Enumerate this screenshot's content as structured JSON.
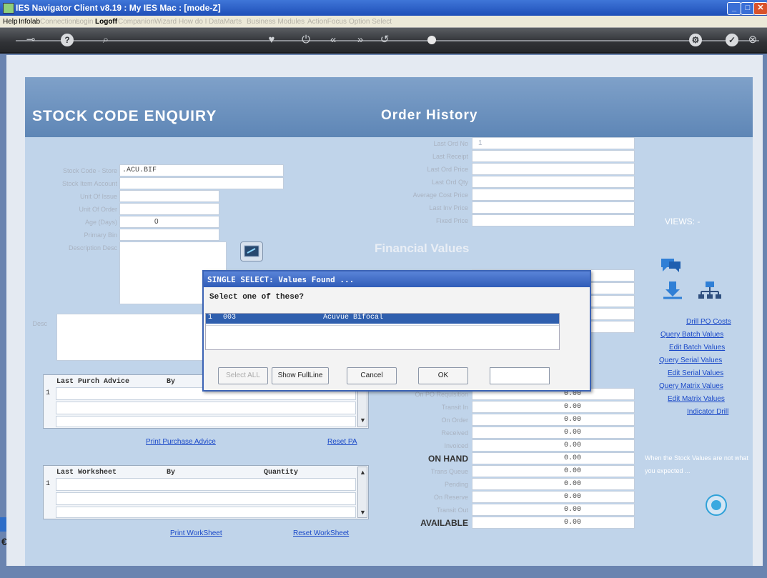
{
  "window": {
    "title": "IES Navigator Client v8.19 : My IES  Mac :      [mode-Z]"
  },
  "menu": {
    "items": [
      "Help",
      "Infolab",
      "Connections",
      "Login",
      "Logoff",
      "Companion",
      "Wizard",
      "How do I",
      "DataMarts",
      "Business Modules",
      "ActionFocus",
      "Option Select"
    ]
  },
  "header": {
    "left_title": "STOCK  CODE  ENQUIRY",
    "right_title": "Order History"
  },
  "stock": {
    "code_label": "Stock Code - Store",
    "code_value": ".ACU.BIF",
    "account_label": "Stock Item Account",
    "uoi_label": "Unit Of Issue",
    "uou_label": "Unit Of Order",
    "age_label": "Age (Days)",
    "age_value": "0",
    "primary_label": "Primary Bin",
    "description_label": "Description Desc",
    "desc_label": "Desc"
  },
  "order_history": {
    "labels": [
      "Last Ord No",
      "Last Receipt",
      "Last Ord Price",
      "Last Ord Qty",
      "Average Cost Price",
      "Last Inv Price",
      "Fixed Price"
    ],
    "values": [
      "1",
      "",
      "",
      "",
      "",
      "",
      ""
    ]
  },
  "financial": {
    "title": "Financial Values"
  },
  "quantities": {
    "labels": [
      "On PO Requisition",
      "Transit In",
      "On Order",
      "Received",
      "Invoiced",
      "ON HAND",
      "Trans Queue",
      "Pending",
      "On Reserve",
      "Transit Out",
      "AVAILABLE"
    ],
    "values": [
      "0.00",
      "0.00",
      "0.00",
      "0.00",
      "0.00",
      "0.00",
      "0.00",
      "0.00",
      "0.00",
      "0.00",
      "0.00"
    ]
  },
  "purchase_grid": {
    "col1": "Last Purch Advice",
    "col2": "By",
    "row_no": "1",
    "print_link": "Print Purchase Advice",
    "reset_link": "Reset PA"
  },
  "worksheet_grid": {
    "col1": "Last Worksheet",
    "col2": "By",
    "col3": "Quantity",
    "row_no": "1",
    "print_link": "Print WorkSheet",
    "reset_link": "Reset WorkSheet"
  },
  "views": {
    "title": "VIEWS: -",
    "links": [
      "Drill PO Costs",
      "Query Batch Values",
      "Edit Batch Values",
      "Query Serial Values",
      "Edit Serial Values",
      "Query Matrix Values",
      "Edit Matrix Values",
      "Indicator Drill"
    ],
    "note": "When the Stock Values are not what you expected ..."
  },
  "dialog": {
    "title": "SINGLE SELECT: Values Found ...",
    "prompt": "Select one of these?",
    "row": {
      "num": "1",
      "code": "003",
      "desc": "Acuvue Bifocal"
    },
    "buttons": {
      "select_all": "Select ALL",
      "full_line": "Show FullLine",
      "cancel": "Cancel",
      "ok": "OK"
    }
  },
  "colors": {
    "accent": "#2f5cb8",
    "selection": "#2f5fae",
    "link": "#1a49c8"
  }
}
